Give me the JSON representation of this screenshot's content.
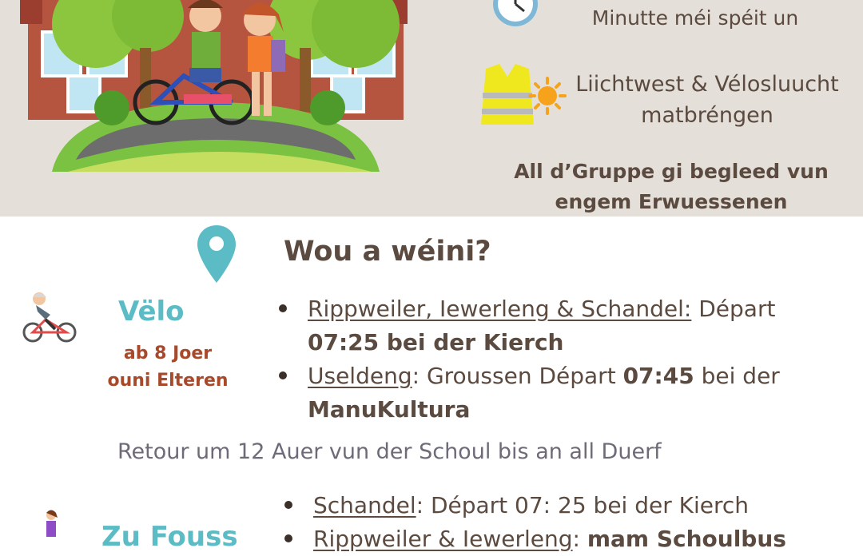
{
  "schedule": {
    "clock_icon": "clock-icon",
    "clock_caption": "Minutte méi spéit un",
    "vest_icon": "safety-vest-icon",
    "light_icon": "sun-light-icon",
    "vest_caption_line1": "Liichtwest & Vélosluucht",
    "vest_caption_line2": "matbréngen",
    "group_note_line1": "All d’Gruppe gi begleed vun",
    "group_note_line2": "engem Erwuessenen"
  },
  "where": {
    "pin_icon": "location-pin-icon",
    "title": "Wou a wéini?"
  },
  "bike": {
    "icon": "cyclist-icon",
    "label": "Vëlo",
    "age_line1": "ab 8 Joer",
    "age_line2": "ouni Elteren",
    "items": [
      {
        "place": "Rippweiler, Iewerleng & Schandel:",
        "text1": " Départ ",
        "strong": "07:25 bei der Kierch",
        "text2": ""
      },
      {
        "place": "Useldeng",
        "text1": ": Groussen Départ ",
        "strong": "07:45",
        "text2": " bei der ",
        "strong2": "ManuKultura"
      }
    ],
    "return_note": "Retour um 12 Auer vun der Schoul bis an all Duerf"
  },
  "walk": {
    "icon": "walking-person-icon",
    "label": "Zu Fouss",
    "items": [
      {
        "place": "Schandel",
        "text1": ": Départ 07: 25 bei der Kierch"
      },
      {
        "place": "Rippweiler & Iewerleng",
        "text1": ": ",
        "strong": "mam Schoulbus"
      }
    ]
  },
  "colors": {
    "band": "#e4e0d9",
    "teal": "#5bbcc6",
    "rust": "#a8492a",
    "text": "#5b4a3f"
  }
}
